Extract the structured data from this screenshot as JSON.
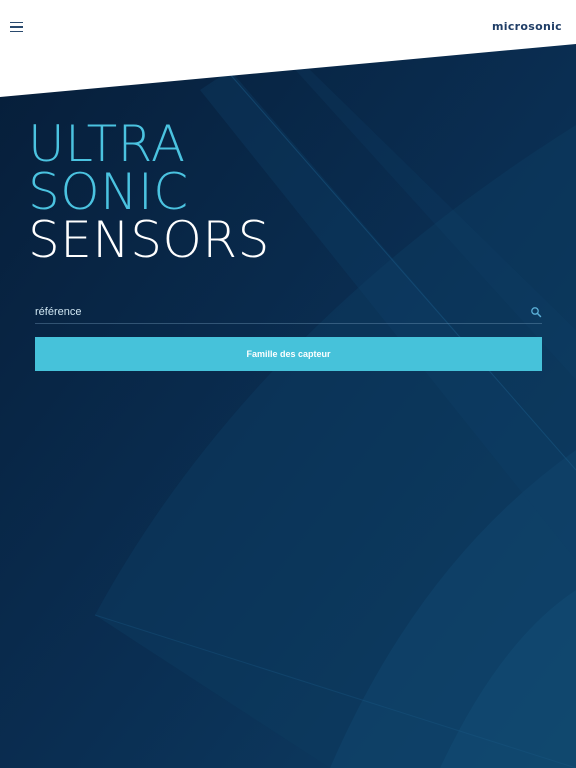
{
  "header": {
    "menu_icon": "hamburger-menu-icon",
    "logo_text": "microsonic"
  },
  "hero": {
    "line1": "ULTRA",
    "line2": "SONIC",
    "line3": "SENSORS"
  },
  "search": {
    "placeholder": "référence",
    "icon": "search-icon"
  },
  "family_button": {
    "label": "Famille des capteur"
  },
  "colors": {
    "background_dark": "#0b2a4a",
    "accent": "#46c2da",
    "hero_blue": "#4bc3e0",
    "logo": "#1f3d66"
  }
}
